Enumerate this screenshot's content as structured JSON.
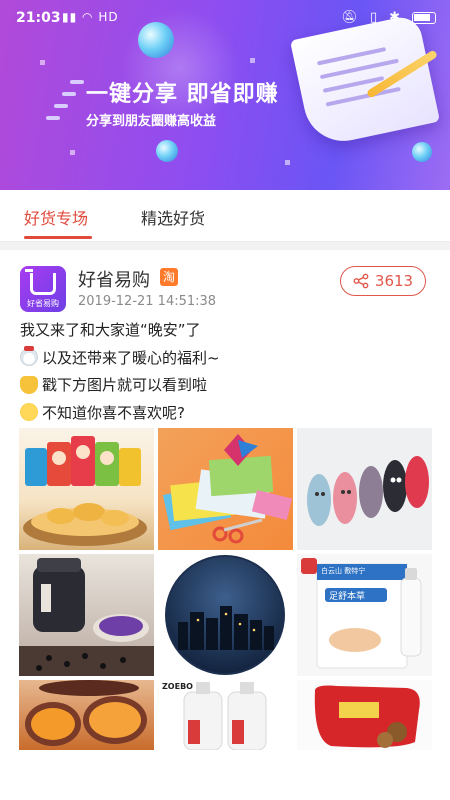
{
  "status_bar": {
    "time": "21:03",
    "network": "HD"
  },
  "banner": {
    "title": "一键分享 即省即赚",
    "subtitle": "分享到朋友圈赚高收益"
  },
  "tabs": [
    {
      "label": "好货专场",
      "active": true
    },
    {
      "label": "精选好货",
      "active": false
    }
  ],
  "post": {
    "shop_name": "好省易购",
    "shop_badge": "淘",
    "timestamp": "2019-12-21 14:51:38",
    "share_count": "3613",
    "lines": [
      "我又来了和大家道“晚安”了",
      "以及还带来了暖心的福利~",
      "戳下方图片就可以看到啦",
      "不知道你喜不喜欢呢?"
    ],
    "line_icons": [
      "",
      "snowman-icon",
      "pointing-down-icon",
      "wink-face-icon"
    ],
    "images": [
      "chips-product-image",
      "origami-paper-product-image",
      "slippers-product-image",
      "black-bean-jar-product-image",
      "night-city-picture-product-image",
      "foot-cream-product-image",
      "sweet-potato-product-image",
      "shampoo-bottles-product-image",
      "dried-tofu-snack-product-image"
    ],
    "product_texts": {
      "foot_cream_brand": "白云山 敷特宁",
      "foot_cream_name": "足舒本草",
      "shampoo_brand": "ZOEBO"
    }
  },
  "colors": {
    "accent": "#e04a3c",
    "banner_start": "#b14ad9",
    "banner_end": "#6a55f5"
  }
}
